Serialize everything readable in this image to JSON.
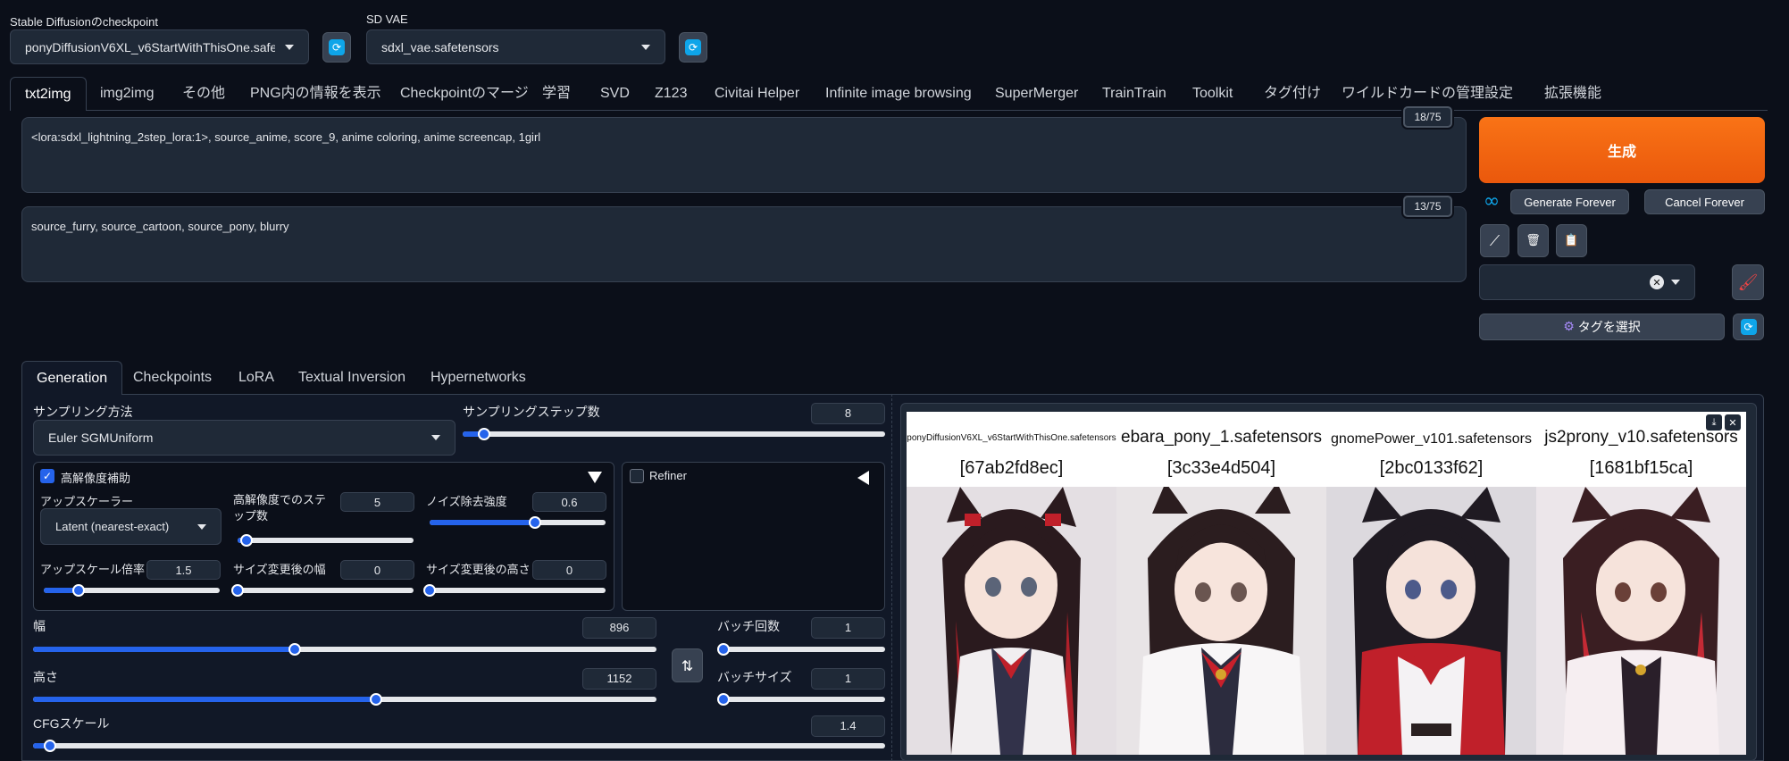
{
  "top": {
    "checkpoint_label": "Stable Diffusionのcheckpoint",
    "checkpoint_value": "ponyDiffusionV6XL_v6StartWithThisOne.safetensors",
    "vae_label": "SD VAE",
    "vae_value": "sdxl_vae.safetensors"
  },
  "tabs": [
    "txt2img",
    "img2img",
    "その他",
    "PNG内の情報を表示",
    "Checkpointのマージ",
    "学習",
    "SVD",
    "Z123",
    "Civitai Helper",
    "Infinite image browsing",
    "SuperMerger",
    "TrainTrain",
    "Toolkit",
    "タグ付け",
    "ワイルドカードの管理",
    "設定",
    "拡張機能"
  ],
  "prompt": {
    "positive": "<lora:sdxl_lightning_2step_lora:1>, source_anime, score_9, anime coloring, anime screencap, 1girl",
    "positive_count": "18/75",
    "negative": "source_furry, source_cartoon, source_pony, blurry",
    "negative_count": "13/75"
  },
  "actions": {
    "generate": "生成",
    "generate_forever": "Generate Forever",
    "cancel_forever": "Cancel Forever",
    "tag_select": "タグを選択"
  },
  "subtabs": [
    "Generation",
    "Checkpoints",
    "LoRA",
    "Textual Inversion",
    "Hypernetworks"
  ],
  "sampling": {
    "method_label": "サンプリング方法",
    "method_value": "Euler SGMUniform",
    "steps_label": "サンプリングステップ数",
    "steps_value": "8",
    "steps_frac": 0.05
  },
  "hires": {
    "label": "高解像度補助",
    "upscaler_label": "アップスケーラー",
    "upscaler_value": "Latent (nearest-exact)",
    "steps_label": "高解像度でのステップ数",
    "steps_value": "5",
    "steps_frac": 0.05,
    "denoise_label": "ノイズ除去強度",
    "denoise_value": "0.6",
    "denoise_frac": 0.6,
    "scale_label": "アップスケール倍率",
    "scale_value": "1.5",
    "scale_frac": 0.2,
    "width_label": "サイズ変更後の幅",
    "width_value": "0",
    "width_frac": 0,
    "height_label": "サイズ変更後の高さ",
    "height_value": "0",
    "height_frac": 0
  },
  "refiner": {
    "label": "Refiner"
  },
  "size": {
    "width_label": "幅",
    "width_value": "896",
    "width_frac": 0.42,
    "height_label": "高さ",
    "height_value": "1152",
    "height_frac": 0.55,
    "batch_count_label": "バッチ回数",
    "batch_count_value": "1",
    "batch_count_frac": 0,
    "batch_size_label": "バッチサイズ",
    "batch_size_value": "1",
    "batch_size_frac": 0,
    "cfg_label": "CFGスケール",
    "cfg_value": "1.4",
    "cfg_frac": 0.02
  },
  "output": {
    "images": [
      {
        "name": "ponyDiffusionV6XL_v6StartWithThisOne.safetensors",
        "hash": "[67ab2fd8ec]"
      },
      {
        "name": "ebara_pony_1.safetensors",
        "hash": "[3c33e4d504]"
      },
      {
        "name": "gnomePower_v101.safetensors",
        "hash": "[2bc0133f62]"
      },
      {
        "name": "js2prony_v10.safetensors",
        "hash": "[1681bf15ca]"
      }
    ]
  },
  "colors": {
    "accent": "#ea580c",
    "slider": "#2563eb",
    "background": "#0b0f19"
  }
}
